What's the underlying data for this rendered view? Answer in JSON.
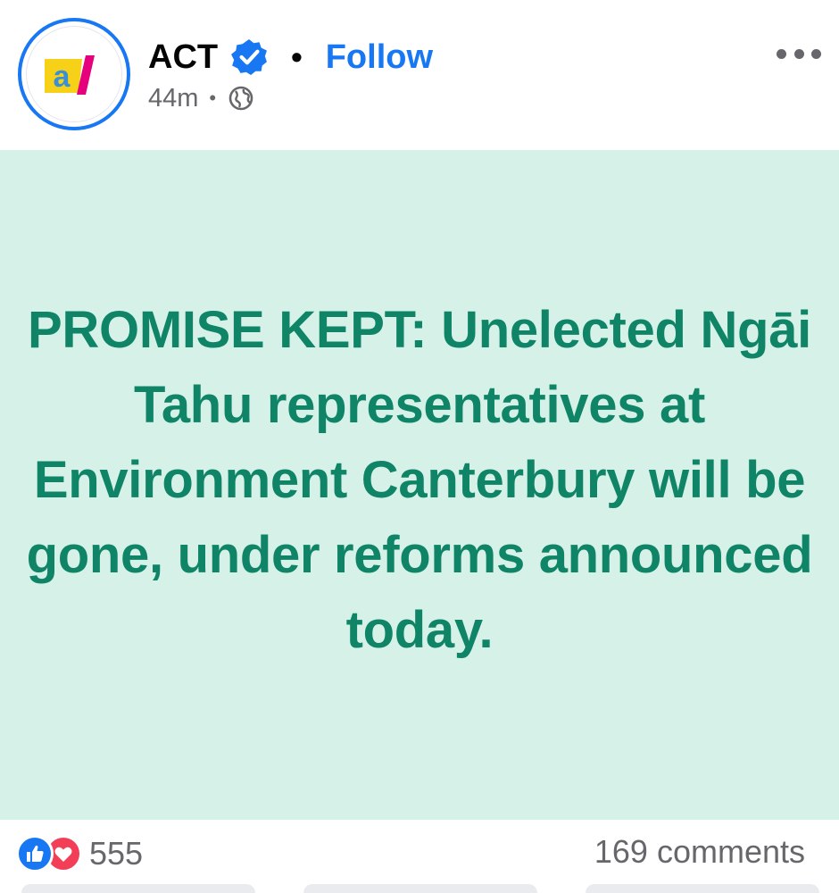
{
  "post": {
    "author": {
      "name": "ACT",
      "verified": true,
      "logo_text": "a/",
      "avatar_colors": {
        "ring": "#1877f2",
        "logo_yellow": "#f7d117",
        "logo_blue": "#3a8fd6",
        "logo_pink": "#e6007e"
      }
    },
    "separator": "•",
    "follow_label": "Follow",
    "timestamp": "44m",
    "meta_separator": "•",
    "privacy_icon": "globe-icon",
    "more_icon": "more-options-icon",
    "body": {
      "text": "PROMISE KEPT: Unelected Ngāi Tahu representatives at Environment Canterbury will be gone, under reforms announced today.",
      "background_color": "#d6f2e8",
      "text_color": "#0f8466"
    },
    "reactions": {
      "icons": [
        "like-icon",
        "love-icon"
      ],
      "count": "555"
    },
    "comments_label": "169 comments"
  },
  "colors": {
    "accent": "#1877f2",
    "secondary_text": "#65676b",
    "love": "#f33e58"
  }
}
